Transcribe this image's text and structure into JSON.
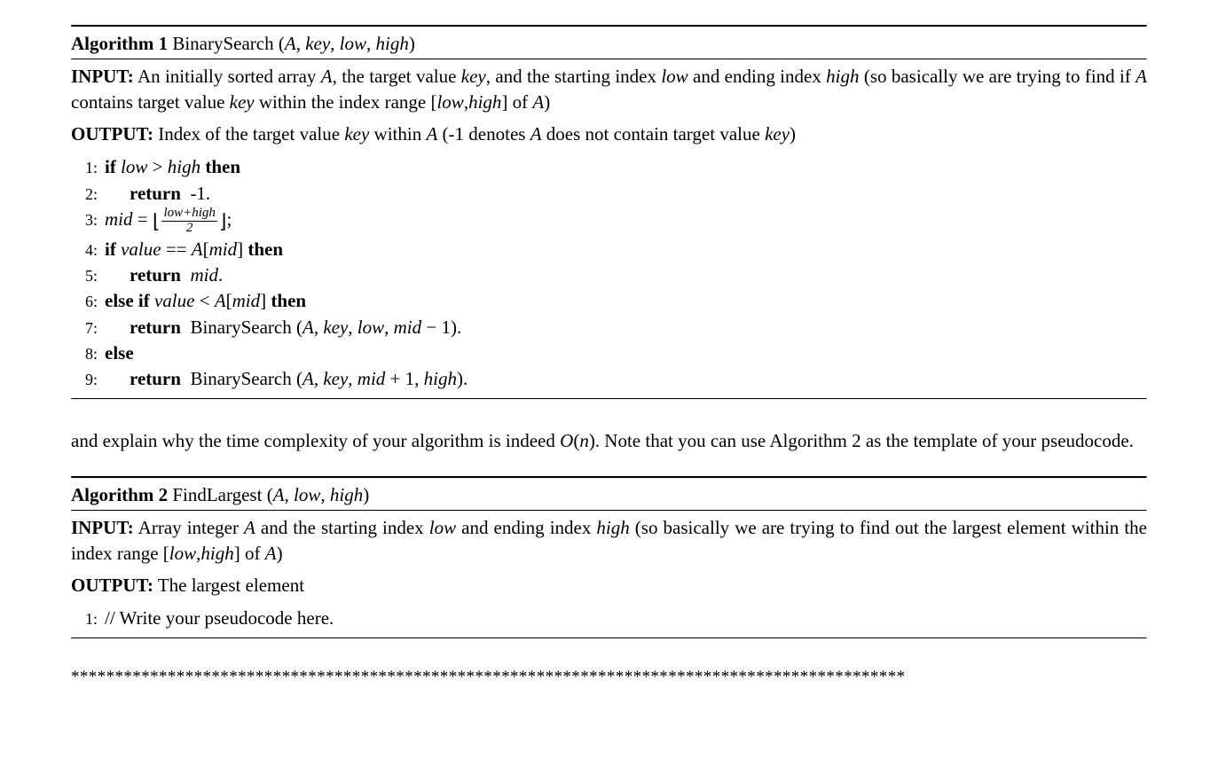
{
  "algo1": {
    "heading_label": "Algorithm 1",
    "name": "BinarySearch",
    "params_html": "(<span class='it'>A</span>, <span class='it'>key</span>, <span class='it'>low</span>, <span class='it'>high</span>)",
    "input_label": "INPUT:",
    "input_html": "An initially sorted array <span class='it'>A</span>, the target value <span class='it'>key</span>, and the starting index <span class='it'>low</span> and ending index <span class='it'>high</span> (so basically we are trying to find if <span class='it'>A</span> contains target value <span class='it'>key</span> within the index range [<span class='it'>low</span>,<span class='it'>high</span>] of <span class='it'>A</span>)",
    "output_label": "OUTPUT:",
    "output_html": "Index of the target value <span class='it'>key</span> within <span class='it'>A</span> (-1 denotes <span class='it'>A</span> does not contain target value <span class='it'>key</span>)",
    "steps": [
      {
        "n": "1:",
        "indent": 0,
        "html": "<span class='kw'>if</span> <span class='it'>low</span> &gt; <span class='it'>high</span> <span class='kw'>then</span>"
      },
      {
        "n": "2:",
        "indent": 1,
        "html": "<span class='kw'>return</span>&nbsp; -1."
      },
      {
        "n": "3:",
        "indent": 0,
        "html": "<span class='it'>mid</span> = <span class='floorL'>⌊</span><span class='frac'><span class='top'>low+high</span><span class='bot'>2</span></span><span class='floorR'>⌋</span>;"
      },
      {
        "n": "4:",
        "indent": 0,
        "html": "<span class='kw'>if</span> <span class='it'>value</span> == <span class='it'>A</span>[<span class='it'>mid</span>] <span class='kw'>then</span>"
      },
      {
        "n": "5:",
        "indent": 1,
        "html": "<span class='kw'>return</span>&nbsp; <span class='it'>mid</span>."
      },
      {
        "n": "6:",
        "indent": 0,
        "html": "<span class='kw'>else if</span> <span class='it'>value</span> &lt; <span class='it'>A</span>[<span class='it'>mid</span>] <span class='kw'>then</span>"
      },
      {
        "n": "7:",
        "indent": 1,
        "html": "<span class='kw'>return</span>&nbsp; BinarySearch (<span class='it'>A</span>, <span class='it'>key</span>, <span class='it'>low</span>, <span class='it'>mid</span> − 1)."
      },
      {
        "n": "8:",
        "indent": 0,
        "html": "<span class='kw'>else</span>"
      },
      {
        "n": "9:",
        "indent": 1,
        "html": "<span class='kw'>return</span>&nbsp; BinarySearch (<span class='it'>A</span>, <span class='it'>key</span>, <span class='it'>mid</span> + 1, <span class='it'>high</span>)."
      }
    ]
  },
  "middle_para_html": "and explain why the time complexity of your algorithm is indeed <span class='it'>O</span>(<span class='it'>n</span>). Note that you can use Algorithm 2 as the template of your pseudocode.",
  "algo2": {
    "heading_label": "Algorithm 2",
    "name": "FindLargest",
    "params_html": "(<span class='it'>A</span>, <span class='it'>low</span>, <span class='it'>high</span>)",
    "input_label": "INPUT:",
    "input_html": "Array integer <span class='it'>A</span> and the starting index <span class='it'>low</span> and ending index <span class='it'>high</span> (so basically we are trying to find out the largest element within the index range [<span class='it'>low</span>,<span class='it'>high</span>] of <span class='it'>A</span>)",
    "output_label": "OUTPUT:",
    "output_html": "The largest element",
    "steps": [
      {
        "n": "1:",
        "indent": 0,
        "html": "// Write your pseudocode here."
      }
    ]
  },
  "stars": "***********************************************************************************************"
}
